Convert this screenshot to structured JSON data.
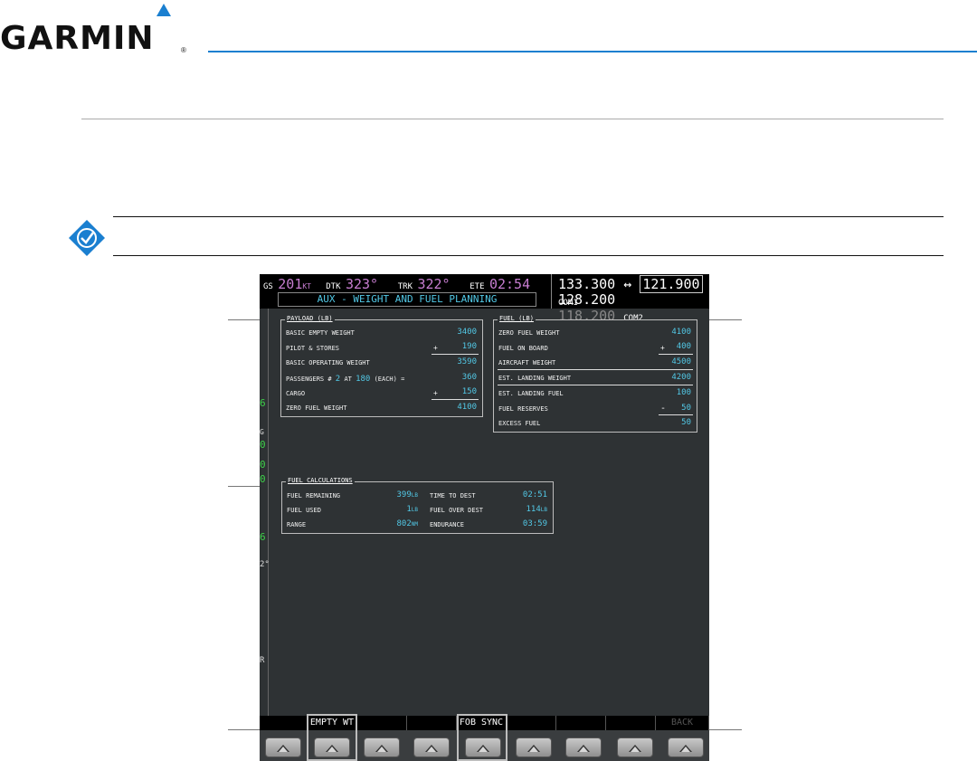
{
  "brand": {
    "name": "GARMIN",
    "registered": "®",
    "accent": "#1a7fd0"
  },
  "mfd": {
    "nav": {
      "gs_label": "GS",
      "gs_value": "201",
      "gs_unit": "KT",
      "dtk_label": "DTK",
      "dtk_value": "323°",
      "trk_label": "TRK",
      "trk_value": "322°",
      "ete_label": "ETE",
      "ete_value": "02:54"
    },
    "page_title": "AUX - WEIGHT AND FUEL PLANNING",
    "com": {
      "com1_active": "133.300",
      "swap": "↔",
      "com1_standby": "121.900",
      "com1_label": "COM1",
      "com2_active": "128.200",
      "com2_standby": "118.200",
      "com2_label": "COM2"
    },
    "left_strip": [
      "6",
      "G",
      "0",
      "0",
      "0",
      "6",
      "2°",
      "R"
    ],
    "payload": {
      "title": "PAYLOAD (LB)",
      "rows": [
        {
          "label": "BASIC EMPTY WEIGHT",
          "sign": "",
          "value": "3400"
        },
        {
          "label": "PILOT & STORES",
          "sign": "+",
          "value": "190"
        },
        {
          "label": "BASIC OPERATING WEIGHT",
          "sign": "",
          "value": "3590"
        },
        {
          "label": "PASSENGERS #",
          "passengers_count": "2",
          "at_label": "AT",
          "each_weight": "180",
          "each_label": "(EACH) =",
          "value": "360"
        },
        {
          "label": "CARGO",
          "sign": "+",
          "value": "150"
        },
        {
          "label": "ZERO FUEL WEIGHT",
          "sign": "",
          "value": "4100"
        }
      ]
    },
    "fuel": {
      "title": "FUEL (LB)",
      "rows": [
        {
          "label": "ZERO FUEL WEIGHT",
          "sign": "",
          "value": "4100"
        },
        {
          "label": "FUEL ON BOARD",
          "sign": "+",
          "value": "400"
        },
        {
          "label": "AIRCRAFT WEIGHT",
          "sign": "",
          "value": "4500"
        },
        {
          "label": "EST. LANDING WEIGHT",
          "sign": "",
          "value": "4200"
        },
        {
          "label": "EST. LANDING FUEL",
          "sign": "",
          "value": "100"
        },
        {
          "label": "FUEL RESERVES",
          "sign": "-",
          "value": "50"
        },
        {
          "label": "EXCESS FUEL",
          "sign": "",
          "value": "50"
        }
      ]
    },
    "calc": {
      "title": "FUEL CALCULATIONS",
      "left": [
        {
          "label": "FUEL REMAINING",
          "value": "399",
          "unit": "LB"
        },
        {
          "label": "FUEL USED",
          "value": "1",
          "unit": "LB"
        },
        {
          "label": "RANGE",
          "value": "802",
          "unit": "NM"
        }
      ],
      "right": [
        {
          "label": "TIME TO DEST",
          "value": "02:51",
          "unit": ""
        },
        {
          "label": "FUEL OVER DEST",
          "value": "114",
          "unit": "LB"
        },
        {
          "label": "ENDURANCE",
          "value": "03:59",
          "unit": ""
        }
      ]
    },
    "softkeys": [
      "",
      "EMPTY WT",
      "",
      "",
      "FOB SYNC",
      "",
      "",
      "",
      "BACK"
    ]
  }
}
